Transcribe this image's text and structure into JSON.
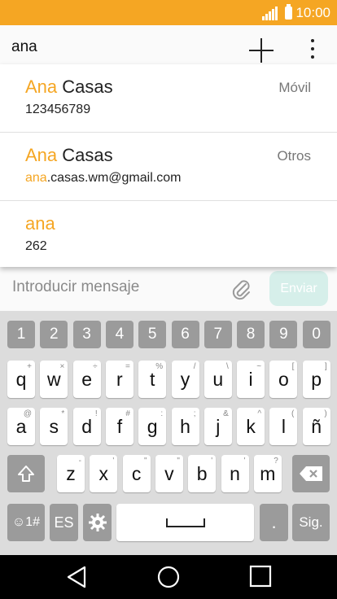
{
  "status_bar": {
    "time": "10:00",
    "icons": [
      "signal-icon",
      "battery-icon"
    ],
    "color": "#f5a623"
  },
  "recipient": {
    "value": "ana"
  },
  "toolbar": {
    "add_icon": "plus-icon",
    "menu_icon": "more-vert-icon"
  },
  "suggestions": [
    {
      "name_match": "Ana",
      "name_rest": " Casas",
      "detail_match": "",
      "detail_rest": "123456789",
      "type": "Móvil"
    },
    {
      "name_match": "Ana",
      "name_rest": " Casas",
      "detail_match": "ana",
      "detail_rest": ".casas.wm@gmail.com",
      "type": "Otros"
    },
    {
      "name_match": "ana",
      "name_rest": "",
      "detail_match": "",
      "detail_rest": "262",
      "type": ""
    }
  ],
  "composer": {
    "placeholder": "Introducir mensaje",
    "send_label": "Enviar",
    "attach_icon": "paperclip-icon"
  },
  "keyboard": {
    "number_row": [
      "1",
      "2",
      "3",
      "4",
      "5",
      "6",
      "7",
      "8",
      "9",
      "0"
    ],
    "row1": [
      {
        "key": "q",
        "hint": "+"
      },
      {
        "key": "w",
        "hint": "×"
      },
      {
        "key": "e",
        "hint": "÷"
      },
      {
        "key": "r",
        "hint": "="
      },
      {
        "key": "t",
        "hint": "%"
      },
      {
        "key": "y",
        "hint": "/"
      },
      {
        "key": "u",
        "hint": "\\"
      },
      {
        "key": "i",
        "hint": "~"
      },
      {
        "key": "o",
        "hint": "["
      },
      {
        "key": "p",
        "hint": "]"
      }
    ],
    "row2": [
      {
        "key": "a",
        "hint": "@"
      },
      {
        "key": "s",
        "hint": "*"
      },
      {
        "key": "d",
        "hint": "!"
      },
      {
        "key": "f",
        "hint": "#"
      },
      {
        "key": "g",
        "hint": ":"
      },
      {
        "key": "h",
        "hint": ";"
      },
      {
        "key": "j",
        "hint": "&"
      },
      {
        "key": "k",
        "hint": "^"
      },
      {
        "key": "l",
        "hint": "("
      },
      {
        "key": "ñ",
        "hint": ")"
      }
    ],
    "row3": [
      {
        "key": "z",
        "hint": "-"
      },
      {
        "key": "x",
        "hint": "'"
      },
      {
        "key": "c",
        "hint": "\""
      },
      {
        "key": "v",
        "hint": "\""
      },
      {
        "key": "b",
        "hint": "'"
      },
      {
        "key": "n",
        "hint": "'"
      },
      {
        "key": "m",
        "hint": "?"
      }
    ],
    "shift_icon": "shift-icon",
    "backspace_icon": "backspace-icon",
    "emoji_label": "☺1#",
    "lang_label": "ES",
    "settings_icon": "gear-icon",
    "space_icon": "space-icon",
    "period_label": ".",
    "next_label": "Sig."
  },
  "nav_bar": {
    "icons": [
      "back-icon",
      "home-icon",
      "recent-apps-icon"
    ]
  }
}
